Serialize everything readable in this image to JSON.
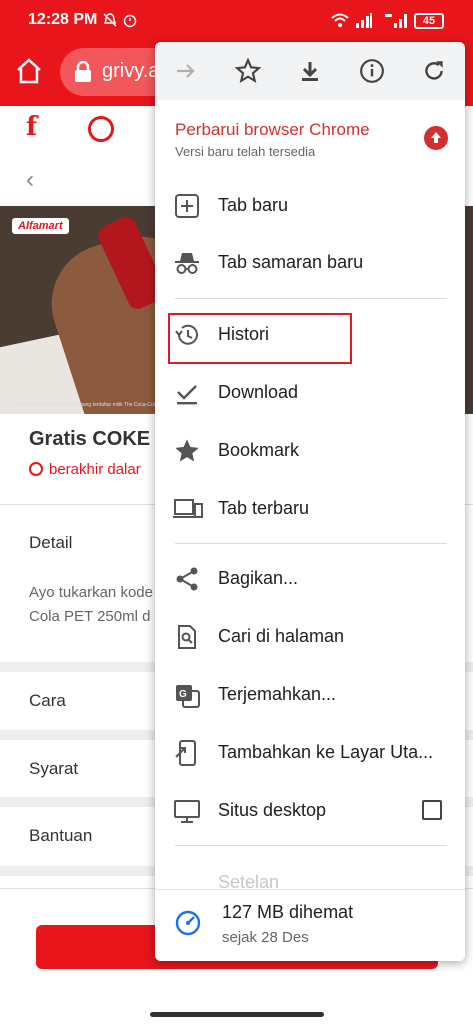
{
  "status_bar": {
    "time": "12:28 PM",
    "battery": "45"
  },
  "url_bar": {
    "url": "grivy.a"
  },
  "page": {
    "brand_badge": "Alfamart",
    "disclaimer": "COCA-COLA adalah merek dagang terdaftar milik The Coca-Cola C",
    "title": "Gratis COKE A",
    "ends_text": "berakhir dalar",
    "detail_label": "Detail",
    "detail_text": [
      "Ayo tukarkan kode",
      "Cola PET 250ml d"
    ],
    "sections": [
      "Cara",
      "Syarat",
      "Bantuan"
    ]
  },
  "menu": {
    "update_title": "Perbarui browser Chrome",
    "update_subtitle": "Versi baru telah tersedia",
    "items": [
      {
        "label": "Tab baru",
        "icon": "add-box-icon"
      },
      {
        "label": "Tab samaran baru",
        "icon": "incognito-icon"
      },
      {
        "label": "Histori",
        "icon": "history-icon"
      },
      {
        "label": "Download",
        "icon": "download-check-icon"
      },
      {
        "label": "Bookmark",
        "icon": "star-icon"
      },
      {
        "label": "Tab terbaru",
        "icon": "devices-icon"
      },
      {
        "label": "Bagikan...",
        "icon": "share-icon"
      },
      {
        "label": "Cari di halaman",
        "icon": "find-in-page-icon"
      },
      {
        "label": "Terjemahkan...",
        "icon": "translate-icon"
      },
      {
        "label": "Tambahkan ke Layar Uta...",
        "icon": "add-to-homescreen-icon"
      },
      {
        "label": "Situs desktop",
        "icon": "desktop-icon",
        "checked": false
      }
    ],
    "settings_label": "Setelan",
    "data_saved": "127 MB dihemat",
    "data_saved_since": "sejak 28 Des"
  },
  "colors": {
    "brand_red": "#e8151b",
    "menu_red": "#d32f2f"
  }
}
